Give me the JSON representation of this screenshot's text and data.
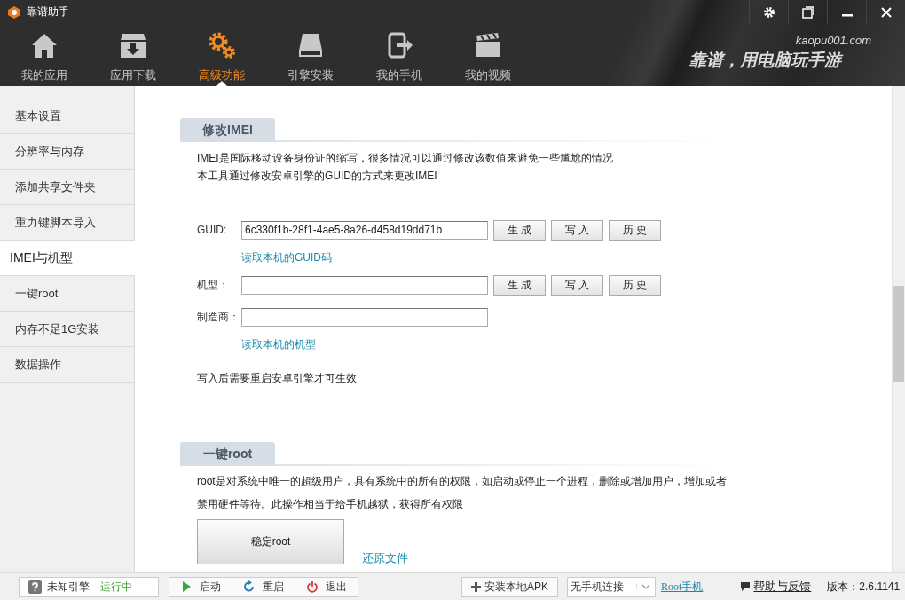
{
  "window": {
    "title": "靠谱助手"
  },
  "header": {
    "tabs": [
      {
        "label": "我的应用",
        "selected": false
      },
      {
        "label": "应用下载",
        "selected": false
      },
      {
        "label": "高级功能",
        "selected": true
      },
      {
        "label": "引擎安装",
        "selected": false
      },
      {
        "label": "我的手机",
        "selected": false
      },
      {
        "label": "我的视频",
        "selected": false
      }
    ],
    "site": "kaopu001.com",
    "slogan": "靠谱，用电脑玩手游"
  },
  "sidebar": {
    "items": [
      {
        "label": "基本设置",
        "selected": false
      },
      {
        "label": "分辨率与内存",
        "selected": false
      },
      {
        "label": "添加共享文件夹",
        "selected": false
      },
      {
        "label": "重力键脚本导入",
        "selected": false
      },
      {
        "label": "IMEI与机型",
        "selected": true
      },
      {
        "label": "一键root",
        "selected": false
      },
      {
        "label": "内存不足1G安装",
        "selected": false
      },
      {
        "label": "数据操作",
        "selected": false
      }
    ]
  },
  "imei": {
    "title": "修改IMEI",
    "description": [
      "IMEI是国际移动设备身份证的缩写，很多情况可以通过修改该数值来避免一些尴尬的情况",
      "本工具通过修改安卓引擎的GUID的方式来更改IMEI"
    ],
    "rows": [
      {
        "kind": "field",
        "label": "GUID:",
        "value": "6c330f1b-28f1-4ae5-8a26-d458d19dd71b",
        "buttons": [
          "生 成",
          "写 入",
          "历 史"
        ]
      },
      {
        "kind": "link",
        "text": "读取本机的GUID码"
      },
      {
        "kind": "field",
        "label": "机型：",
        "buttons": [
          "生 成",
          "写 入",
          "历 史"
        ]
      },
      {
        "kind": "field",
        "label": "制造商："
      },
      {
        "kind": "link",
        "text": "读取本机的机型"
      },
      {
        "kind": "note",
        "text": "写入后需要重启安卓引擎才可生效"
      }
    ]
  },
  "root": {
    "title": "一键root",
    "description": "root是对系统中唯一的超级用户，具有系统中的所有的权限，如启动或停止一个进程，删除或增加用户，增加或者禁用硬件等待。此操作相当于给手机越狱，获得所有权限",
    "button": "稳定root",
    "link": "还原文件"
  },
  "status_bar": {
    "engine": "未知引擎",
    "engine_status": "运行中",
    "controls": [
      "启动",
      "重启",
      "退出"
    ],
    "install": "安装本地APK",
    "phone_select": "无手机连接",
    "root_link": "Root手机",
    "help": "帮助与反馈",
    "version": "版本：2.6.1141"
  }
}
